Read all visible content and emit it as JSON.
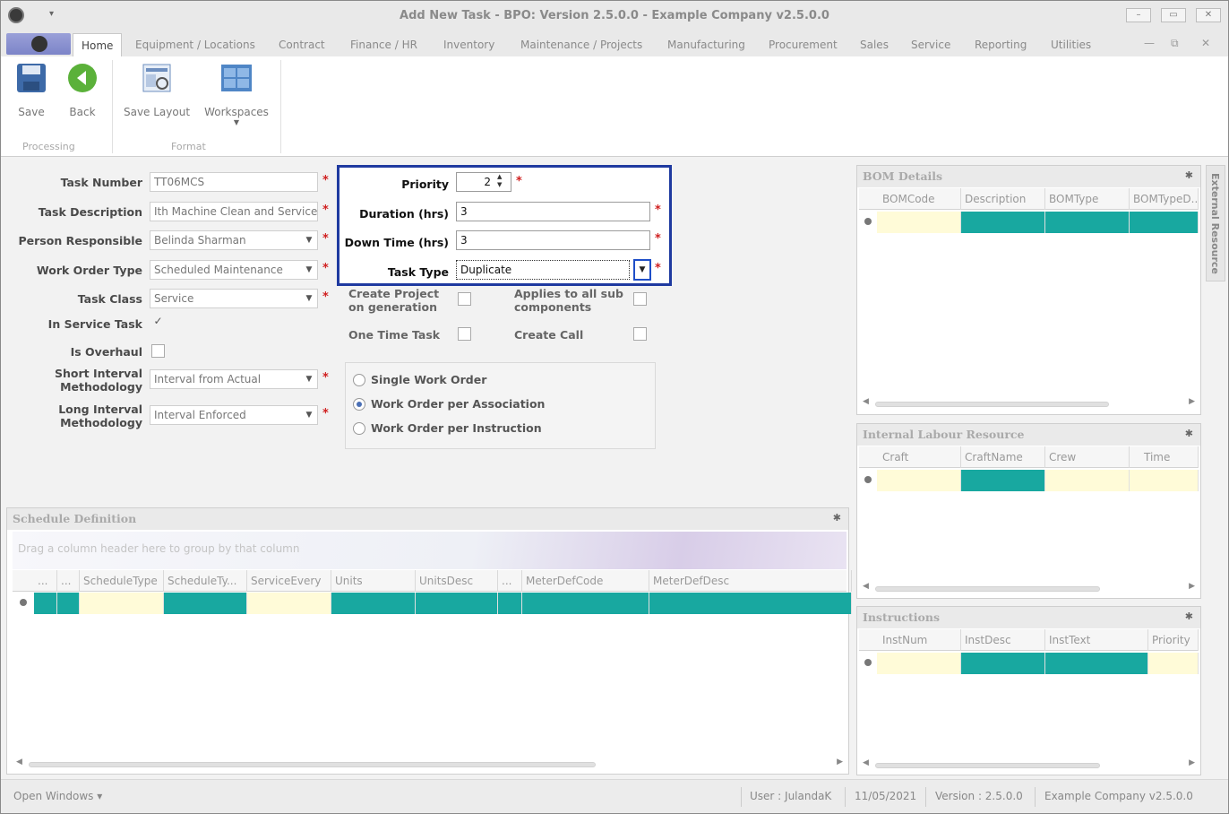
{
  "window": {
    "title": "Add New Task - BPO: Version 2.5.0.0 - Example Company v2.5.0.0",
    "qa": "▾",
    "min": "–",
    "max": "▭",
    "close": "✕"
  },
  "tabs": [
    "Home",
    "Equipment / Locations",
    "Contract",
    "Finance / HR",
    "Inventory",
    "Maintenance / Projects",
    "Manufacturing",
    "Procurement",
    "Sales",
    "Service",
    "Reporting",
    "Utilities"
  ],
  "tab_controls": [
    "—",
    "⧉",
    "✕"
  ],
  "ribbon": {
    "save": "Save",
    "back": "Back",
    "save_layout": "Save Layout",
    "workspaces": "Workspaces",
    "group_processing": "Processing",
    "group_format": "Format"
  },
  "form": {
    "task_number_label": "Task Number",
    "task_number": "TT06MCS",
    "task_description_label": "Task Description",
    "task_description": "Ith Machine Clean and Service",
    "person_responsible_label": "Person Responsible",
    "person_responsible": "Belinda Sharman",
    "work_order_type_label": "Work Order Type",
    "work_order_type": "Scheduled Maintenance",
    "task_class_label": "Task Class",
    "task_class": "Service",
    "in_service_task_label": "In Service Task",
    "in_service_task": "✓",
    "is_overhaul_label": "Is Overhaul",
    "short_interval_label_1": "Short Interval",
    "short_interval_label_2": "Methodology",
    "short_interval": "Interval from Actual",
    "long_interval_label_1": "Long Interval",
    "long_interval_label_2": "Methodology",
    "long_interval": "Interval Enforced",
    "priority_label": "Priority",
    "priority": "2",
    "duration_label": "Duration (hrs)",
    "duration": "3",
    "down_time_label": "Down Time (hrs)",
    "down_time": "3",
    "task_type_label": "Task Type",
    "task_type": "Duplicate",
    "create_project_label_1": "Create Project",
    "create_project_label_2": "on generation",
    "applies_label_1": "Applies to all sub",
    "applies_label_2": "components",
    "one_time_label": "One Time Task",
    "create_call_label": "Create Call",
    "radio_single": "Single Work Order",
    "radio_assoc": "Work Order per Association",
    "radio_instr": "Work Order per Instruction",
    "required": "*"
  },
  "schedule": {
    "title": "Schedule Definition",
    "group_hint": "Drag a column header here to group by that column",
    "columns": [
      "...",
      "...",
      "ScheduleType",
      "ScheduleTy...",
      "ServiceEvery",
      "Units",
      "UnitsDesc",
      "...",
      "MeterDefCode",
      "MeterDefDesc"
    ]
  },
  "bom": {
    "title": "BOM Details",
    "columns": [
      "BOMCode",
      "Description",
      "BOMType",
      "BOMTypeD..."
    ]
  },
  "labour": {
    "title": "Internal Labour Resource",
    "columns": [
      "Craft",
      "CraftName",
      "Crew",
      "Time"
    ]
  },
  "instructions": {
    "title": "Instructions",
    "columns": [
      "InstNum",
      "InstDesc",
      "InstText",
      "Priority"
    ]
  },
  "side_tab": "External Resource",
  "status": {
    "open_windows": "Open Windows ▾",
    "user": "User : JulandaK",
    "date": "11/05/2021",
    "version": "Version : 2.5.0.0",
    "company": "Example Company v2.5.0.0"
  },
  "icons": {
    "pin": "pin-icon",
    "dropdown": "chevron-down-icon"
  }
}
